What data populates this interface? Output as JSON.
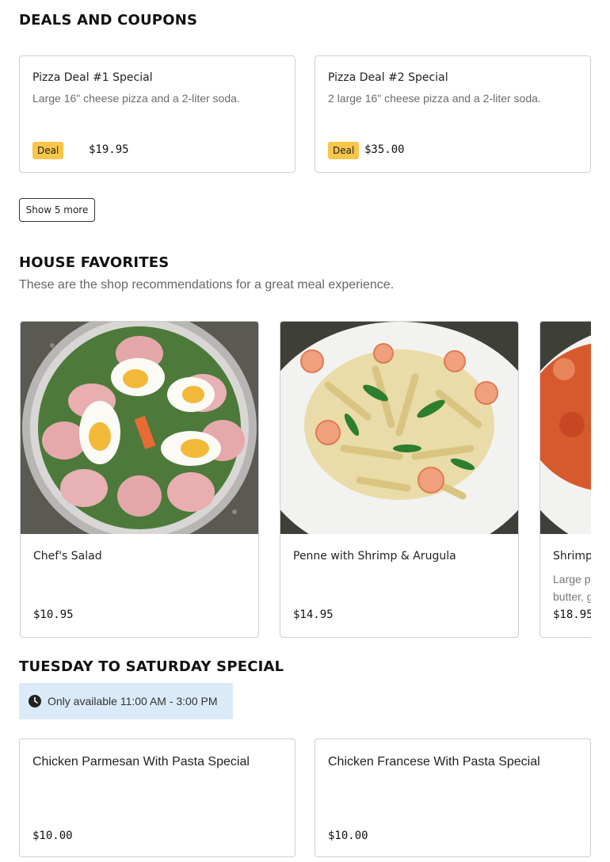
{
  "deals": {
    "title": "DEALS AND COUPONS",
    "items": [
      {
        "title": "Pizza Deal #1 Special",
        "description": "Large 16\" cheese pizza and a 2-liter soda.",
        "badge": "Deal",
        "price": "$19.95"
      },
      {
        "title": "Pizza Deal #2 Special",
        "description": "2 large 16\" cheese pizza and a 2-liter soda.",
        "badge": "Deal",
        "price": "$35.00"
      }
    ],
    "show_more_label": "Show 5 more"
  },
  "favorites": {
    "title": "HOUSE FAVORITES",
    "subtitle": "These are the shop recommendations for a great meal experience.",
    "items": [
      {
        "title": "Chef's Salad",
        "description": "",
        "price": "$10.95"
      },
      {
        "title": "Penne with Shrimp & Arugula",
        "description": "",
        "price": "$14.95"
      },
      {
        "title": "Shrimp",
        "description_line1": "Large p",
        "description_line2": "butter, g",
        "price": "$18.95"
      }
    ]
  },
  "special": {
    "title": "TUESDAY TO SATURDAY SPECIAL",
    "availability": "Only available 11:00 AM - 3:00 PM",
    "items": [
      {
        "title": "Chicken Parmesan With Pasta Special",
        "price": "$10.00"
      },
      {
        "title": "Chicken Francese With Pasta Special",
        "price": "$10.00"
      }
    ]
  },
  "colors": {
    "deal_badge": "#f7c64a",
    "availability_bg": "#dbeaf8"
  },
  "icons": {
    "availability": "clock-icon"
  }
}
